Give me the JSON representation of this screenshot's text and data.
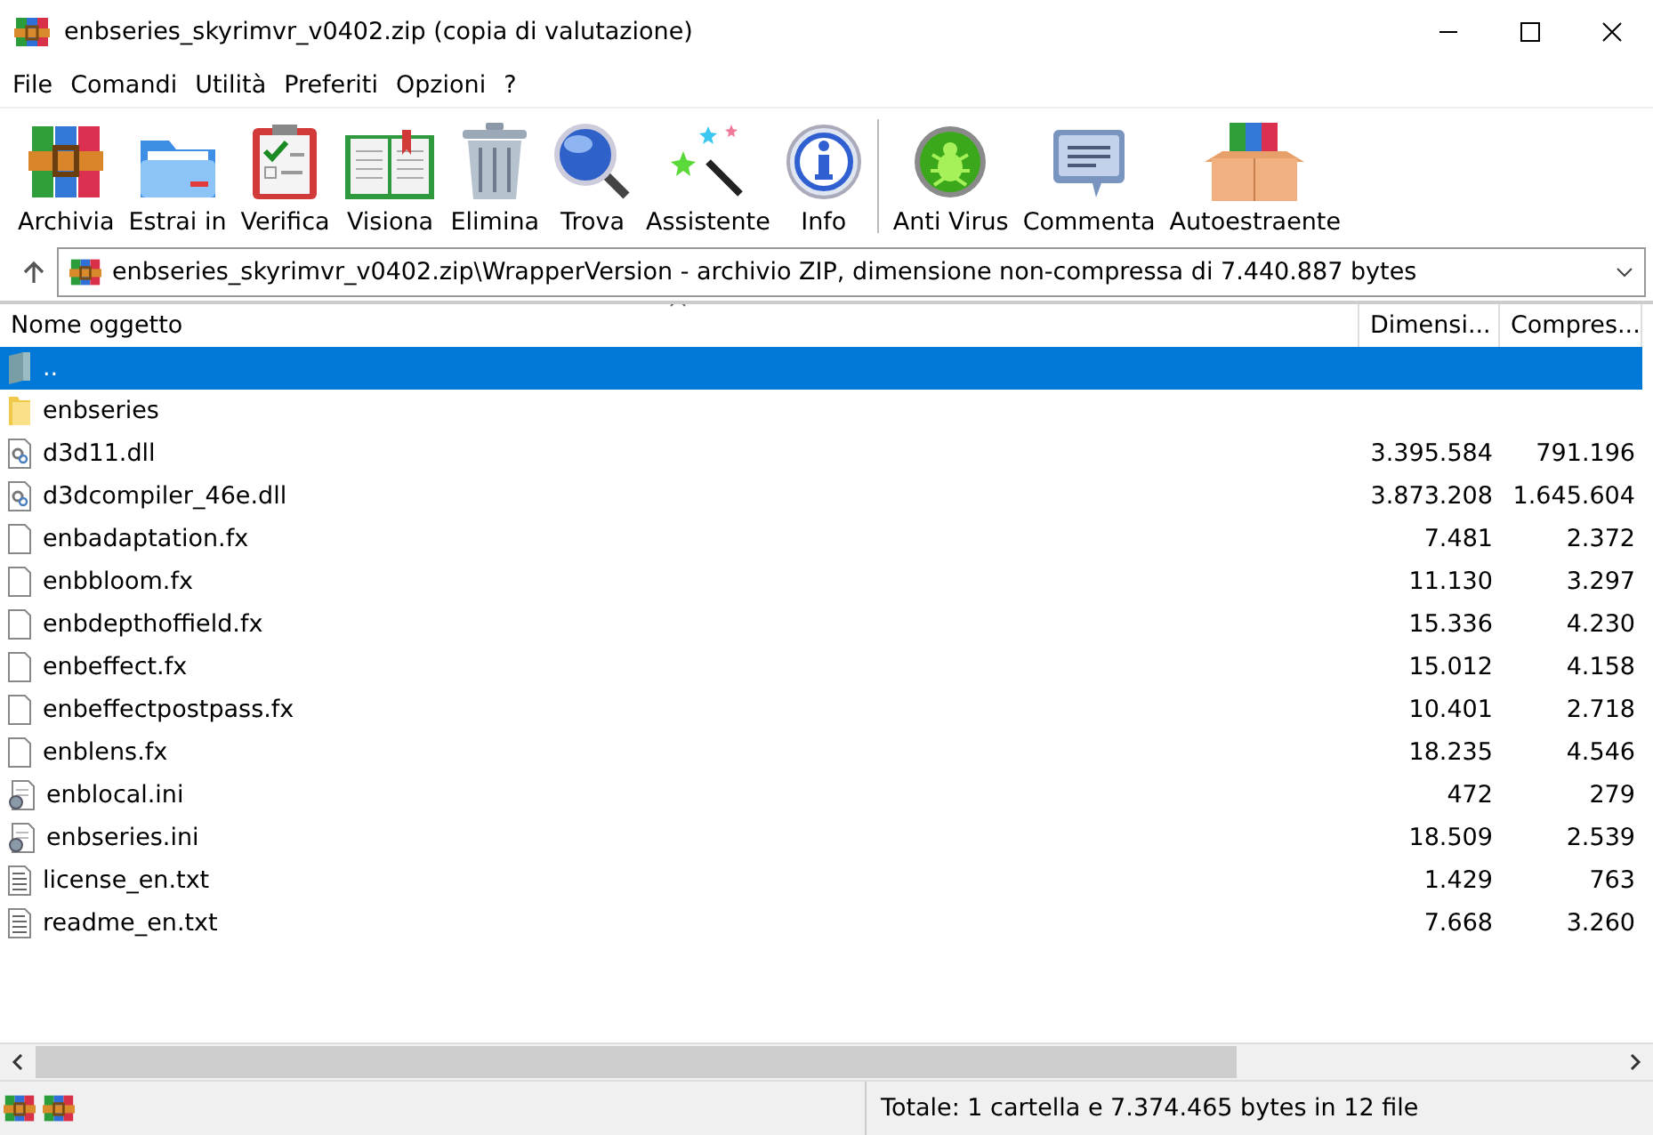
{
  "window": {
    "title": "enbseries_skyrimvr_v0402.zip (copia di valutazione)"
  },
  "menu": [
    "File",
    "Comandi",
    "Utilità",
    "Preferiti",
    "Opzioni",
    "?"
  ],
  "toolbar": [
    {
      "label": "Archivia",
      "kind": "archive"
    },
    {
      "label": "Estrai in",
      "kind": "extract"
    },
    {
      "label": "Verifica",
      "kind": "test"
    },
    {
      "label": "Visiona",
      "kind": "view"
    },
    {
      "label": "Elimina",
      "kind": "delete"
    },
    {
      "label": "Trova",
      "kind": "find"
    },
    {
      "label": "Assistente",
      "kind": "wizard"
    },
    {
      "label": "Info",
      "kind": "info"
    },
    {
      "label": "Anti Virus",
      "kind": "virus",
      "separator_before": true
    },
    {
      "label": "Commenta",
      "kind": "comment"
    },
    {
      "label": "Autoestraente",
      "kind": "sfx"
    }
  ],
  "address": {
    "value": "enbseries_skyrimvr_v0402.zip\\WrapperVersion - archivio ZIP, dimensione non-compressa di 7.440.887 bytes"
  },
  "table": {
    "columns": [
      "Nome oggetto",
      "Dimensi...",
      "Compres..."
    ],
    "rows": [
      {
        "name": "..",
        "kind": "parent",
        "selected": true
      },
      {
        "name": "enbseries",
        "kind": "folder",
        "selected": false
      },
      {
        "name": "d3d11.dll",
        "kind": "dll",
        "size": "3.395.584",
        "packed": "791.196",
        "selected": false
      },
      {
        "name": "d3dcompiler_46e.dll",
        "kind": "dll",
        "size": "3.873.208",
        "packed": "1.645.604",
        "selected": false
      },
      {
        "name": "enbadaptation.fx",
        "kind": "file",
        "size": "7.481",
        "packed": "2.372",
        "selected": false
      },
      {
        "name": "enbbloom.fx",
        "kind": "file",
        "size": "11.130",
        "packed": "3.297",
        "selected": false
      },
      {
        "name": "enbdepthoffield.fx",
        "kind": "file",
        "size": "15.336",
        "packed": "4.230",
        "selected": false
      },
      {
        "name": "enbeffect.fx",
        "kind": "file",
        "size": "15.012",
        "packed": "4.158",
        "selected": false
      },
      {
        "name": "enbeffectpostpass.fx",
        "kind": "file",
        "size": "10.401",
        "packed": "2.718",
        "selected": false
      },
      {
        "name": "enblens.fx",
        "kind": "file",
        "size": "18.235",
        "packed": "4.546",
        "selected": false
      },
      {
        "name": "enblocal.ini",
        "kind": "ini",
        "size": "472",
        "packed": "279",
        "selected": false
      },
      {
        "name": "enbseries.ini",
        "kind": "ini",
        "size": "18.509",
        "packed": "2.539",
        "selected": false
      },
      {
        "name": "license_en.txt",
        "kind": "text",
        "size": "1.429",
        "packed": "763",
        "selected": false
      },
      {
        "name": "readme_en.txt",
        "kind": "text",
        "size": "7.668",
        "packed": "3.260",
        "selected": false
      }
    ]
  },
  "status_bar": {
    "text": "Totale: 1 cartella e 7.374.465 bytes in 12 file"
  }
}
